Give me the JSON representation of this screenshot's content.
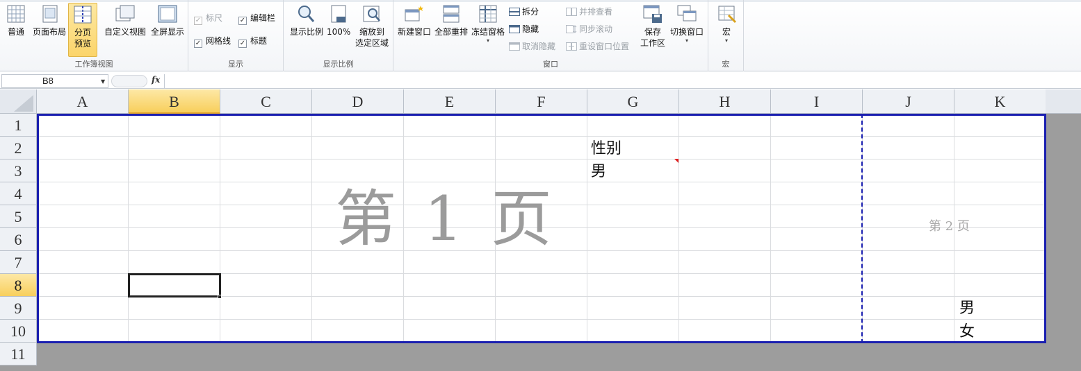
{
  "ribbon": {
    "workbook_views": {
      "group_label": "工作簿视图",
      "normal": "普通",
      "page_layout": "页面布局",
      "page_break_preview_line1": "分页",
      "page_break_preview_line2": "预览",
      "custom_views": "自定义视图",
      "full_screen": "全屏显示"
    },
    "show": {
      "group_label": "显示",
      "ruler": "标尺",
      "formula_bar": "编辑栏",
      "gridlines": "网格线",
      "headings": "标题",
      "ruler_checked": true,
      "formula_bar_checked": true,
      "gridlines_checked": true,
      "headings_checked": true
    },
    "zoom": {
      "group_label": "显示比例",
      "zoom": "显示比例",
      "hundred": "100%",
      "zoom_to_selection_line1": "缩放到",
      "zoom_to_selection_line2": "选定区域"
    },
    "window": {
      "group_label": "窗口",
      "new_window": "新建窗口",
      "arrange_all": "全部重排",
      "freeze_panes": "冻结窗格",
      "split": "拆分",
      "hide": "隐藏",
      "unhide": "取消隐藏",
      "side_by_side": "并排查看",
      "sync_scroll": "同步滚动",
      "reset_position": "重设窗口位置",
      "save_workspace_line1": "保存",
      "save_workspace_line2": "工作区",
      "switch_windows": "切换窗口"
    },
    "macros": {
      "group_label": "宏",
      "macros": "宏"
    }
  },
  "formula_bar": {
    "name_box": "B8",
    "fx": "fx",
    "formula": ""
  },
  "sheet": {
    "columns": [
      "A",
      "B",
      "C",
      "D",
      "E",
      "F",
      "G",
      "H",
      "I",
      "J",
      "K"
    ],
    "rows": [
      "1",
      "2",
      "3",
      "4",
      "5",
      "6",
      "7",
      "8",
      "9",
      "10",
      "11"
    ],
    "selected_column": "B",
    "selected_row": "8",
    "cells": {
      "G2": "性别",
      "G3": "男",
      "K9": "男",
      "K10": "女"
    },
    "page1_watermark": "第 1 页",
    "page2_watermark": "第 2 页",
    "colors": {
      "print_area_border": "#1a1fb0",
      "selection_header": "#f8cf5c",
      "comment_indicator": "#e01d1d"
    }
  }
}
